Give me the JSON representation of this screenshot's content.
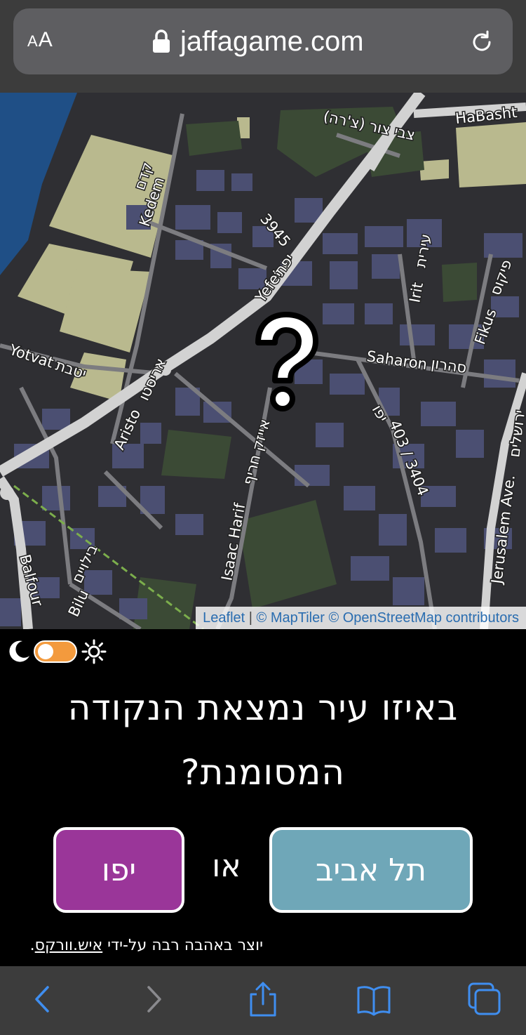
{
  "browser": {
    "text_size_label_small": "A",
    "text_size_label_large": "A",
    "domain": "jaffagame.com",
    "icons": [
      "lock-icon",
      "reload-icon",
      "back-icon",
      "forward-icon",
      "share-icon",
      "bookmarks-icon",
      "tabs-icon"
    ]
  },
  "map": {
    "labels": {
      "street_tzvi_tzur": "צבי צור (צ'רה)",
      "street_habasht": "HaBasht",
      "street_kedem_he": "קדם",
      "street_kedem_en": "Kedem",
      "street_3945": "3945",
      "street_yefet_he": "יפת",
      "street_yefet_en": "Yefet",
      "street_irit_he": "עירית",
      "street_irit_en": "Irit",
      "street_fikus_he": "פיקוס",
      "street_fikus_en": "Fikus",
      "street_saharon_en": "Saharon",
      "street_saharon_he": "סהרון",
      "street_yotvat_en": "Yotvat",
      "street_yotvat_he": "יטבת",
      "street_aristo_en": "Aristo",
      "street_aristo_he": "אריסטו",
      "street_isaac_harif_he": "אייזק חריף",
      "street_isaac_harif_en": "Isaac Harif",
      "street_yafo_he": "יפו",
      "street_403": "403 / 3404",
      "street_jerusalem_he": "ירושלים",
      "street_jerusalem_en": "Jerusalem Ave.",
      "street_balfour_en": "Balfour",
      "street_biluim_he": "בילויים",
      "street_biluim_en": "Bilu"
    },
    "marker_icon": "question-mark-icon",
    "attribution": {
      "leaflet": "Leaflet",
      "separator": "|",
      "maptiler": "© MapTiler",
      "osm": "© OpenStreetMap contributors"
    }
  },
  "theme": {
    "dark_icon": "moon-icon",
    "light_icon": "sun-icon",
    "toggle_color": "#f39a3d"
  },
  "quiz": {
    "question_line1": "באיזו עיר נמצאת הנקודה",
    "question_line2": "המסומנת?",
    "answer_tlv": "תל אביב",
    "answer_tlv_color": "#6fa7b8",
    "or_label": "או",
    "answer_jaffa": "יפו",
    "answer_jaffa_color": "#9a3699"
  },
  "footer": {
    "credit_prefix": "יוצר באהבה רבה על-ידי ",
    "credit_link": "איש.וורקס",
    "credit_suffix": "."
  }
}
